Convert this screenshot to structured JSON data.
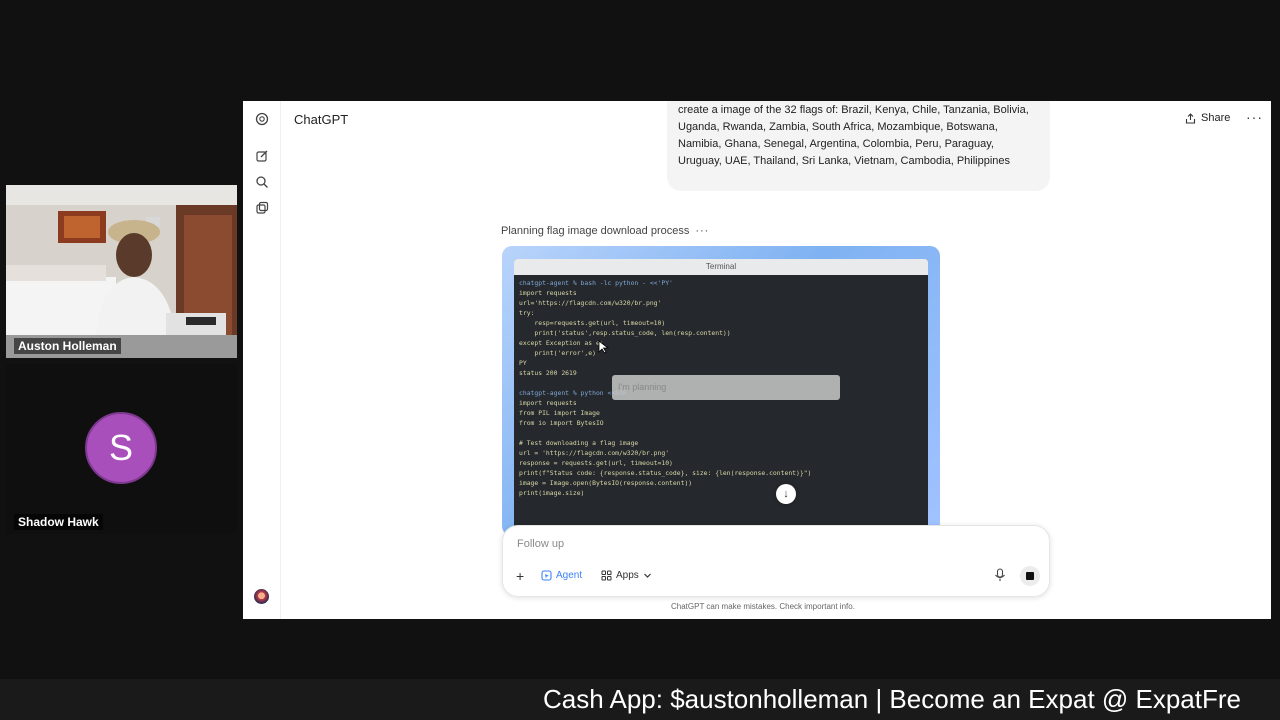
{
  "participants": [
    {
      "name": "Auston Holleman"
    },
    {
      "name": "Shadow Hawk",
      "initial": "S",
      "avatar_color": "#a94fbb"
    }
  ],
  "chatgpt": {
    "title": "ChatGPT",
    "share_label": "Share",
    "user_message": "create a image of the 32 flags of: Brazil, Kenya, Chile, Tanzania, Bolivia, Uganda, Rwanda, Zambia, South Africa, Mozambique, Botswana, Namibia, Ghana, Senegal, Argentina, Colombia, Peru, Paraguay, Uruguay, UAE, Thailand, Sri Lanka, Vietnam, Cambodia, Philippines",
    "status_text": "Planning flag image download process",
    "terminal": {
      "title": "Terminal",
      "lines": [
        "chatgpt-agent % bash -lc python - <<'PY'",
        "import requests",
        "url='https://flagcdn.com/w320/br.png'",
        "try:",
        "    resp=requests.get(url, timeout=10)",
        "    print('status',resp.status_code, len(resp.content))",
        "except Exception as e:",
        "    print('error',e)",
        "PY",
        "status 200 2619",
        "",
        "chatgpt-agent % python <<EOF",
        "import requests",
        "from PIL import Image",
        "from io import BytesIO",
        "",
        "# Test downloading a flag image",
        "url = 'https://flagcdn.com/w320/br.png'",
        "response = requests.get(url, timeout=10)",
        "print(f\"Status code: {response.status_code}, size: {len(response.content)}\")",
        "image = Image.open(BytesIO(response.content))",
        "print(image.size)"
      ],
      "overlay_text": "I'm planning"
    },
    "composer": {
      "placeholder": "Follow up",
      "agent_label": "Agent",
      "apps_label": "Apps"
    },
    "disclaimer": "ChatGPT can make mistakes. Check important info.",
    "accent_color": "#3b82f6"
  },
  "ticker": {
    "text": "Cash App: $austonholleman | Become an Expat @ ExpatFre"
  }
}
